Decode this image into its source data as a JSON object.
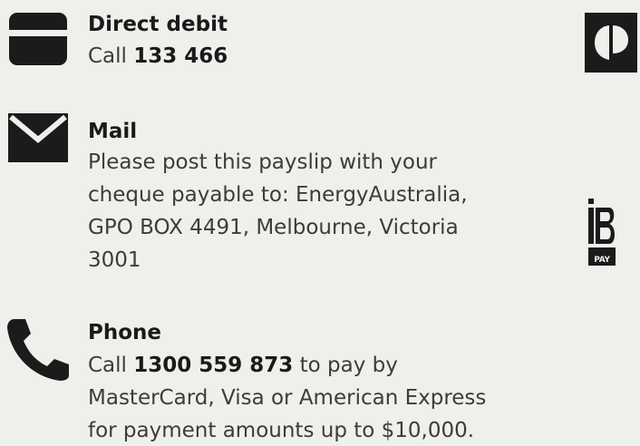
{
  "direct_debit": {
    "title": "Direct debit",
    "call_prefix": "Call ",
    "phone": "133 466",
    "icon": "card-icon"
  },
  "mail": {
    "title": "Mail",
    "lines": [
      "Please post this payslip with your",
      "cheque payable to: EnergyAustralia,",
      "GPO BOX 4491, Melbourne, Victoria",
      "3001"
    ],
    "icon": "envelope-icon"
  },
  "phone": {
    "title": "Phone",
    "call_prefix": "Call ",
    "number": "1300 559 873",
    "call_suffix": " to pay by",
    "lines": [
      "MasterCard, Visa or American Express",
      "for payment amounts up to $10,000."
    ],
    "icon": "phone-icon"
  },
  "logos": {
    "auspost": "australia-post-logo",
    "bpay_text": "PAY"
  }
}
